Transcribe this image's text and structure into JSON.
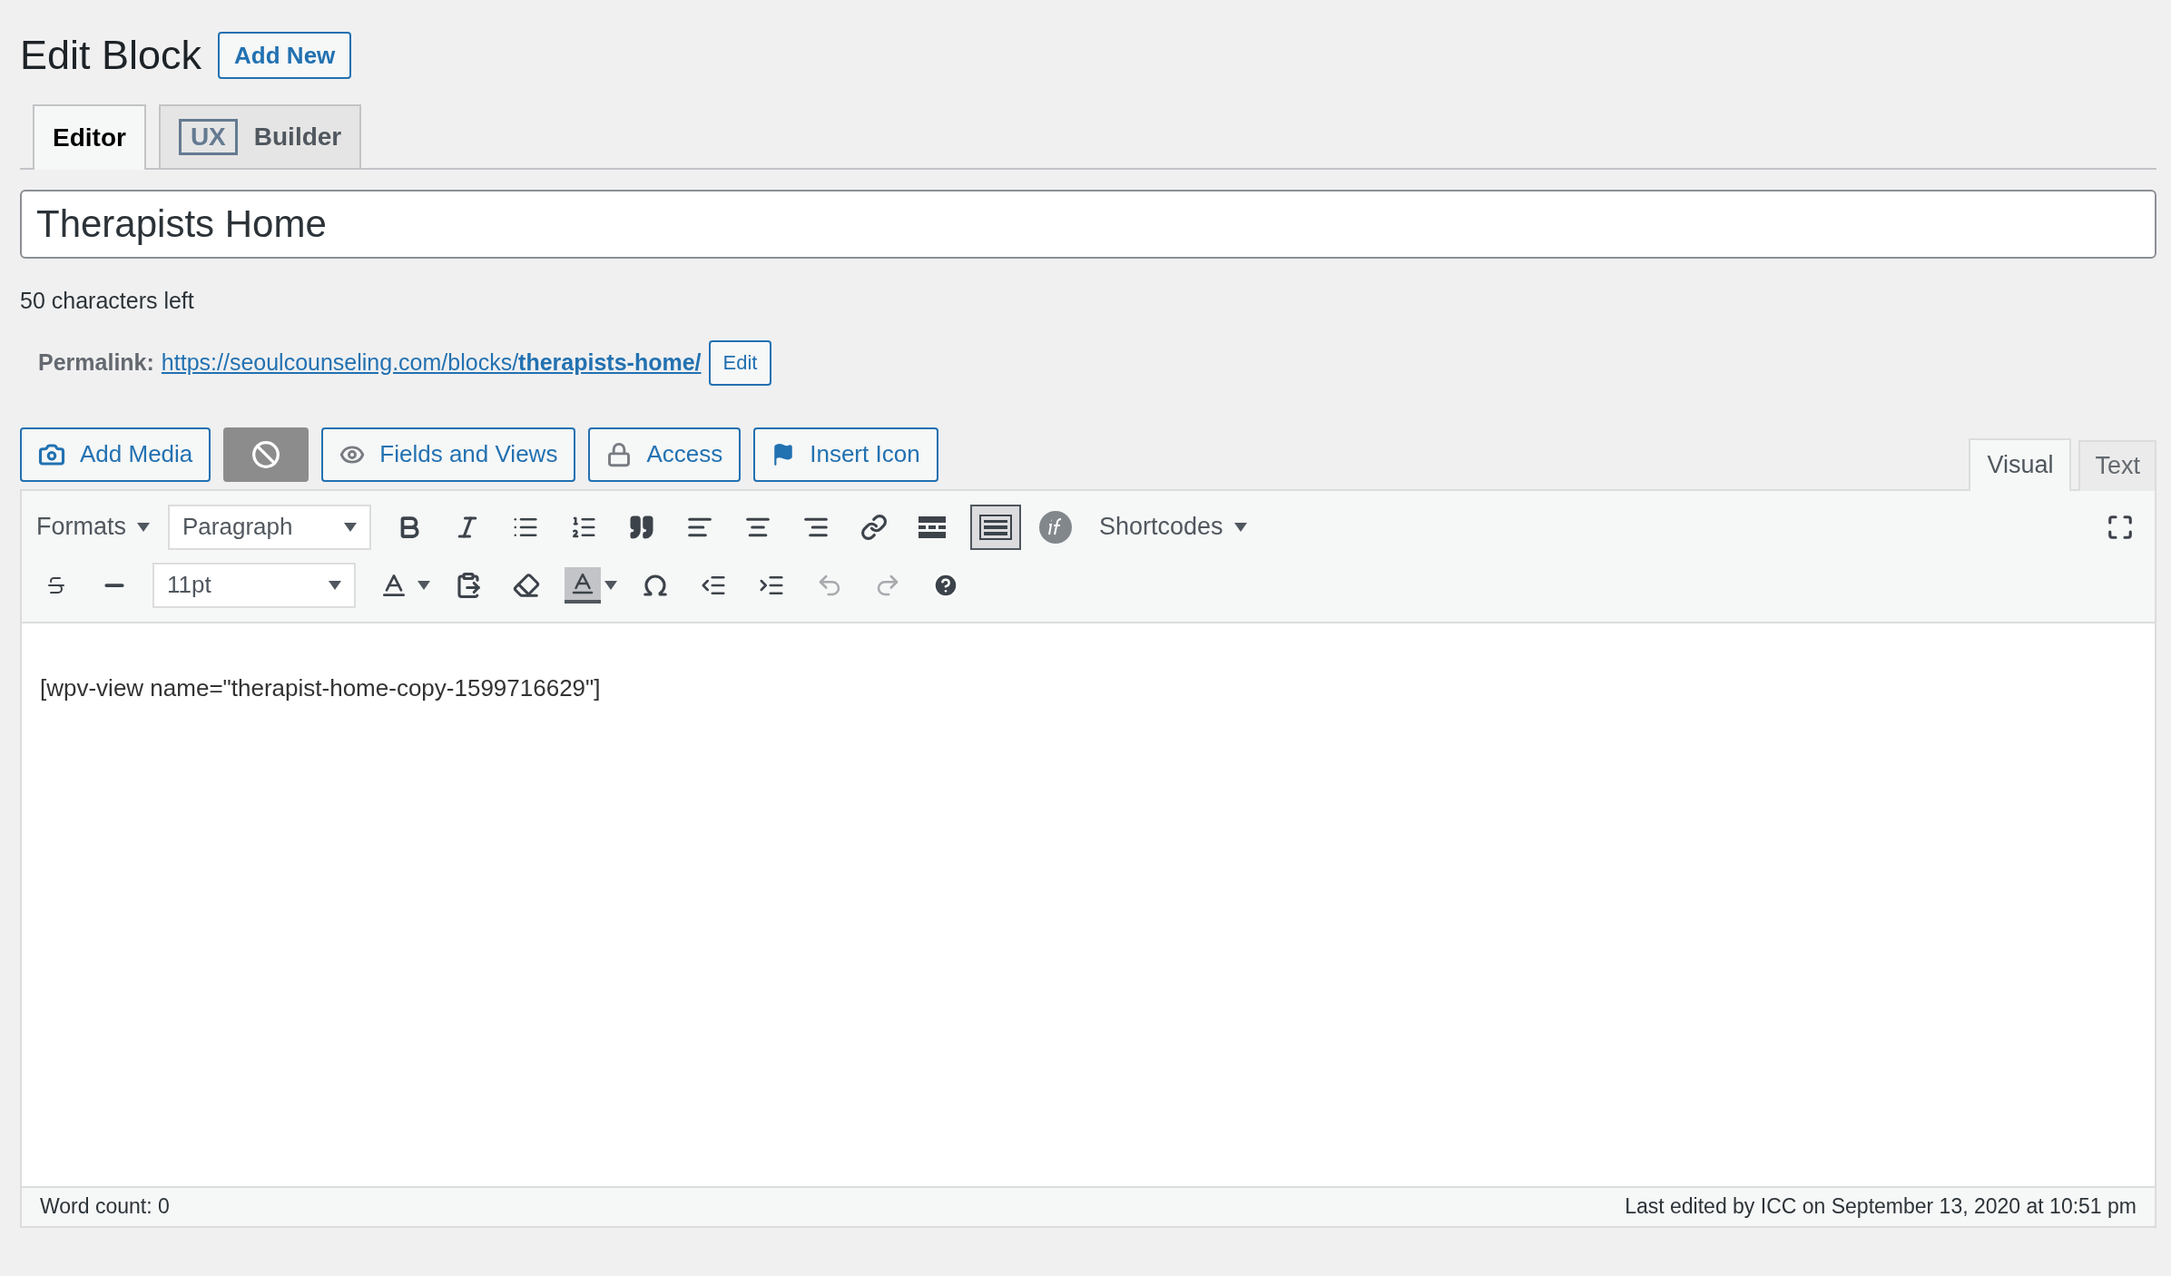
{
  "page": {
    "title": "Edit Block",
    "add_new": "Add New"
  },
  "editor_tabs": [
    {
      "label": "Editor",
      "selected": true
    },
    {
      "badge": "UX",
      "label": "Builder",
      "selected": false
    }
  ],
  "title_field": {
    "value": "Therapists Home"
  },
  "char_counter": "50 characters left",
  "permalink": {
    "label": "Permalink:",
    "url_base": "https://seoulcounseling.com/blocks/",
    "slug": "therapists-home/",
    "edit": "Edit"
  },
  "media_buttons": [
    {
      "kind": "media",
      "label": "Add Media"
    },
    {
      "kind": "icon-only"
    },
    {
      "kind": "fields",
      "label": "Fields and Views"
    },
    {
      "kind": "access",
      "label": "Access"
    },
    {
      "kind": "flag",
      "label": "Insert Icon"
    }
  ],
  "mode_tabs": [
    {
      "label": "Visual",
      "selected": true
    },
    {
      "label": "Text",
      "selected": false
    }
  ],
  "toolbar": {
    "formats": "Formats",
    "block_format": "Paragraph",
    "toolbar_toggle": {
      "pressed": true
    },
    "shortcodes": "Shortcodes",
    "font_size": "11pt"
  },
  "content": "[wpv-view name=\"therapist-home-copy-1599716629\"]",
  "status_bar": {
    "word_count": "Word count: 0",
    "last_edited": "Last edited by ICC on September 13, 2020 at 10:51 pm"
  }
}
